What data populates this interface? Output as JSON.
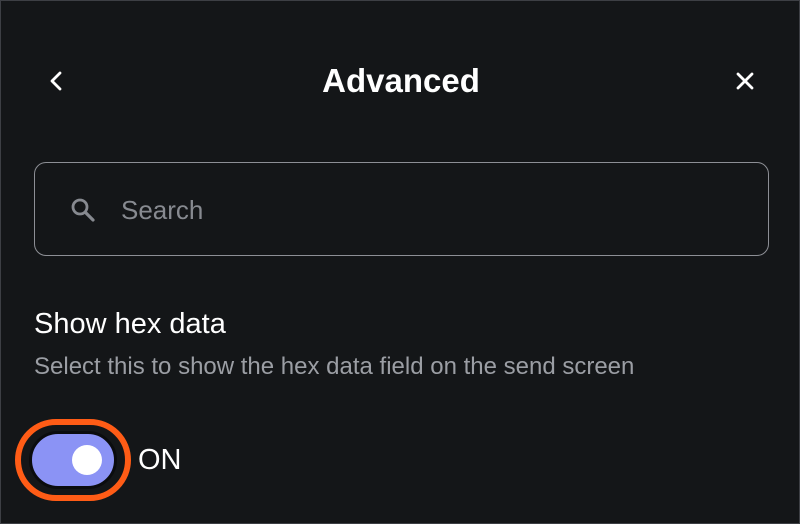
{
  "header": {
    "title": "Advanced",
    "back_icon": "chevron-left-icon",
    "close_icon": "close-icon"
  },
  "search": {
    "placeholder": "Search",
    "value": "",
    "icon": "search-icon"
  },
  "setting": {
    "title": "Show hex data",
    "description": "Select this to show the hex data field on the send screen",
    "toggle": {
      "state": true,
      "label": "ON"
    }
  },
  "colors": {
    "background": "#141618",
    "toggle_track": "#8b93f5",
    "highlight": "#ff5c16",
    "muted_text": "#9b9ea4"
  }
}
